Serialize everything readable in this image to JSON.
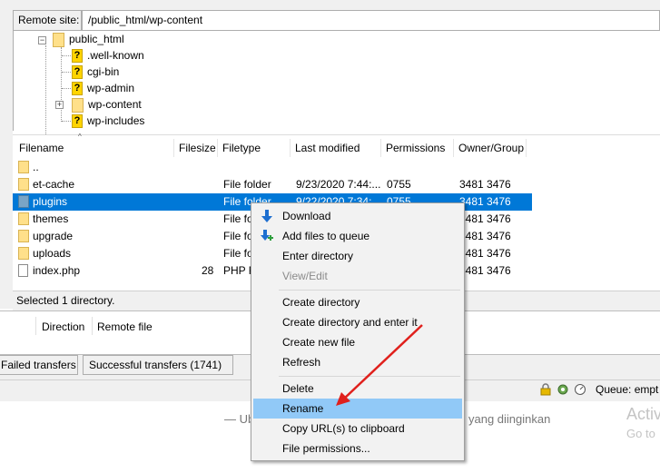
{
  "remote_site": {
    "label": "Remote site:",
    "path": "/public_html/wp-content"
  },
  "tree": {
    "root": "public_html",
    "children": [
      ".well-known",
      "cgi-bin",
      "wp-admin",
      "wp-content",
      "wp-includes"
    ]
  },
  "file_list": {
    "columns": [
      "Filename",
      "Filesize",
      "Filetype",
      "Last modified",
      "Permissions",
      "Owner/Group"
    ],
    "rows": [
      {
        "name": "..",
        "size": "",
        "type": "",
        "modified": "",
        "perms": "",
        "owner": ""
      },
      {
        "name": "et-cache",
        "size": "",
        "type": "File folder",
        "modified": "9/23/2020 7:44:...",
        "perms": "0755",
        "owner": "3481 3476"
      },
      {
        "name": "plugins",
        "size": "",
        "type": "File folder",
        "modified": "9/22/2020 7:34:...",
        "perms": "0755",
        "owner": "3481 3476"
      },
      {
        "name": "themes",
        "size": "",
        "type": "File fo",
        "modified": "",
        "perms": "",
        "owner": "3481 3476"
      },
      {
        "name": "upgrade",
        "size": "",
        "type": "File fo",
        "modified": "",
        "perms": "",
        "owner": "3481 3476"
      },
      {
        "name": "uploads",
        "size": "",
        "type": "File fo",
        "modified": "",
        "perms": "",
        "owner": "3481 3476"
      },
      {
        "name": "index.php",
        "size": "28",
        "type": "PHP F",
        "modified": "",
        "perms": "",
        "owner": "3481 3476"
      }
    ],
    "selected_row": 2,
    "status": "Selected 1 directory."
  },
  "queue": {
    "columns": [
      "Direction",
      "Remote file"
    ],
    "tabs": [
      "Failed transfers",
      "Successful transfers (1741)"
    ],
    "status": "Queue: empt"
  },
  "background_text": {
    "left": "— Ub",
    "right": "yang diinginkan",
    "activate": "Activ",
    "goto": "Go to"
  },
  "context_menu": {
    "items": [
      {
        "label": "Download",
        "icon": "download-arrow-icon"
      },
      {
        "label": "Add files to queue",
        "icon": "add-to-queue-icon"
      },
      {
        "label": "Enter directory"
      },
      {
        "label": "View/Edit",
        "disabled": true
      },
      {
        "label": "Create directory"
      },
      {
        "label": "Create directory and enter it"
      },
      {
        "label": "Create new file"
      },
      {
        "label": "Refresh"
      },
      {
        "label": "Delete"
      },
      {
        "label": "Rename",
        "highlighted": true
      },
      {
        "label": "Copy URL(s) to clipboard"
      },
      {
        "label": "File permissions..."
      }
    ]
  },
  "colors": {
    "selection": "#0078d7",
    "menu_highlight": "#91c9f7",
    "annotation_arrow": "#e0201c"
  }
}
